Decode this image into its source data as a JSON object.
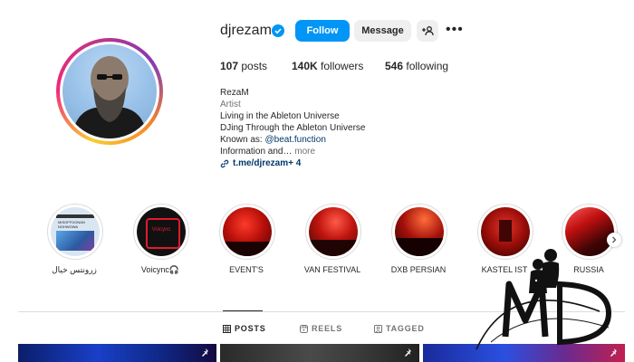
{
  "profile": {
    "username": "djrezam",
    "verified": true,
    "follow_label": "Follow",
    "message_label": "Message",
    "add_person_icon": "add-person-icon",
    "more_icon": "more-icon"
  },
  "stats": {
    "posts_count": "107",
    "posts_label": "posts",
    "followers_count": "140K",
    "followers_label": "followers",
    "following_count": "546",
    "following_label": "following"
  },
  "bio": {
    "name": "RezaM",
    "category": "Artist",
    "line1": "Living in the Ableton Universe",
    "line2": "DJing Through the Ableton Universe",
    "line3_prefix": "Known as: ",
    "line3_mention": "@beat.function",
    "line4": "Information and…",
    "more": " more",
    "link_text": "t.me/djrezam",
    "link_extra": " + 4"
  },
  "highlights": [
    {
      "label": "زرونتس خیال"
    },
    {
      "label": "Voicync🎧"
    },
    {
      "label": "EVENT'S"
    },
    {
      "label": "VAN FESTIVAL"
    },
    {
      "label": "DXB PERSIAN"
    },
    {
      "label": "KASTEL IST"
    },
    {
      "label": "RUSSIA"
    }
  ],
  "highlight_thumb_text": {
    "h1": "MISOFFOONAN NOHWOWA",
    "h2": "Voicync"
  },
  "tabs": [
    {
      "label": "POSTS",
      "icon": "grid-icon",
      "active": true
    },
    {
      "label": "REELS",
      "icon": "reels-icon",
      "active": false
    },
    {
      "label": "TAGGED",
      "icon": "tagged-icon",
      "active": false
    }
  ],
  "colors": {
    "accent": "#0095f6",
    "link": "#00376b",
    "verified": "#0095f6"
  }
}
